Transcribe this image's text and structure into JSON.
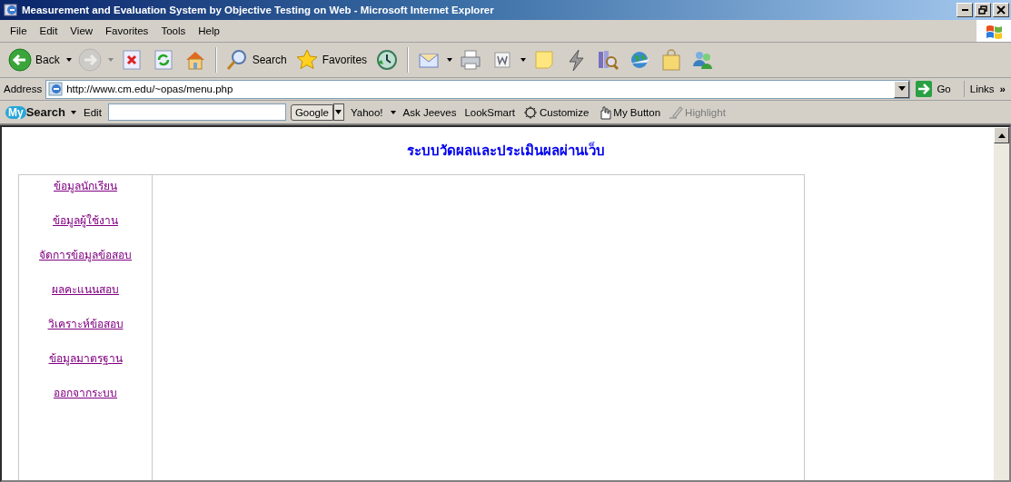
{
  "window": {
    "title": "Measurement and Evaluation System by Objective Testing on Web - Microsoft Internet Explorer"
  },
  "menu": [
    "File",
    "Edit",
    "View",
    "Favorites",
    "Tools",
    "Help"
  ],
  "toolbar": [
    {
      "kind": "back",
      "label": "Back",
      "dropdown": true,
      "disabled": false
    },
    {
      "kind": "forward",
      "dropdown": true,
      "disabled": true
    },
    {
      "kind": "stop",
      "dropdown": false,
      "disabled": false
    },
    {
      "kind": "refresh",
      "dropdown": false,
      "disabled": false
    },
    {
      "kind": "home",
      "dropdown": false,
      "disabled": false
    },
    {
      "kind": "search",
      "label": "Search",
      "dropdown": false,
      "disabled": false
    },
    {
      "kind": "favorites",
      "label": "Favorites",
      "dropdown": false,
      "disabled": false
    },
    {
      "kind": "history",
      "dropdown": false,
      "disabled": false
    },
    {
      "kind": "mail",
      "dropdown": true,
      "disabled": false
    },
    {
      "kind": "print",
      "dropdown": false,
      "disabled": false
    },
    {
      "kind": "edit",
      "dropdown": true,
      "disabled": false
    },
    {
      "kind": "note",
      "dropdown": false,
      "disabled": false
    },
    {
      "kind": "bolt",
      "dropdown": false,
      "disabled": false
    },
    {
      "kind": "books",
      "dropdown": false,
      "disabled": false
    },
    {
      "kind": "globe",
      "dropdown": false,
      "disabled": false
    },
    {
      "kind": "bag",
      "dropdown": false,
      "disabled": false
    },
    {
      "kind": "people",
      "dropdown": false,
      "disabled": false
    }
  ],
  "address": {
    "label": "Address",
    "url": "http://www.cm.edu/~opas/menu.php",
    "go": "Go",
    "links": "Links",
    "more": "»"
  },
  "search_bar": {
    "logo_badge": "My",
    "logo_text": "Search",
    "edit": "Edit",
    "engine": "Google",
    "items": [
      {
        "label": "Yahoo!",
        "dropdown": true,
        "disabled": false,
        "kind": "text"
      },
      {
        "label": "Ask Jeeves",
        "dropdown": false,
        "disabled": false,
        "kind": "text"
      },
      {
        "label": "LookSmart",
        "dropdown": false,
        "disabled": false,
        "kind": "text"
      },
      {
        "label": "Customize",
        "dropdown": false,
        "disabled": false,
        "kind": "gear"
      },
      {
        "label": "My Button",
        "dropdown": false,
        "disabled": false,
        "kind": "hand"
      },
      {
        "label": "Highlight",
        "dropdown": false,
        "disabled": true,
        "kind": "pen"
      }
    ]
  },
  "page": {
    "heading": "ระบบวัดผลและประเมินผลผ่านเว็บ",
    "nav": [
      "ข้อมูลนักเรียน",
      "ข้อมูลผู้ใช้งาน",
      "จัดการข้อมูลข้อสอบ",
      "ผลคะแนนสอบ",
      "วิเคราะห์ข้อสอบ",
      "ข้อมูลมาตรฐาน",
      "ออกจากระบบ"
    ]
  }
}
